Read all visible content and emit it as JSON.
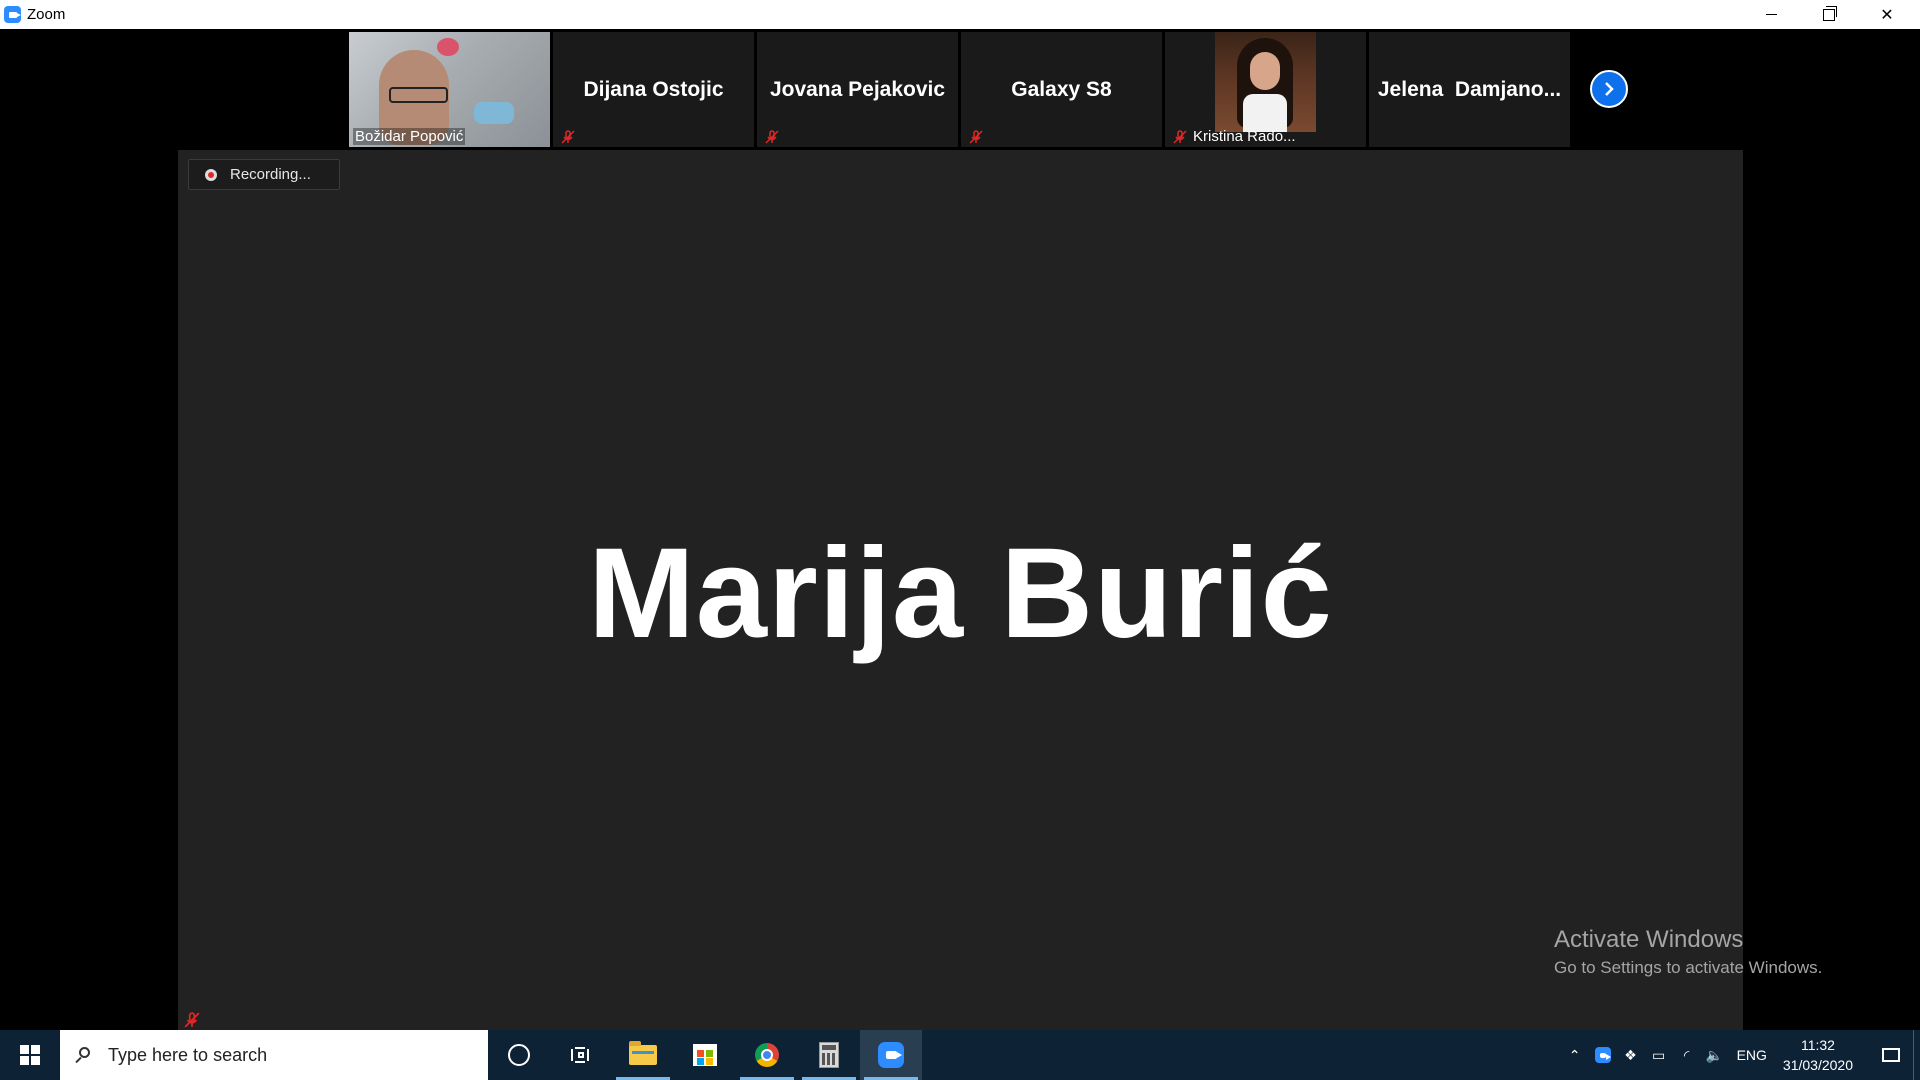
{
  "window": {
    "title": "Zoom"
  },
  "gallery": [
    {
      "name": "Božidar Popović",
      "type": "video",
      "muted": false
    },
    {
      "name": "Dijana Ostojic",
      "type": "name",
      "muted": true
    },
    {
      "name": "Jovana Pejakovic",
      "type": "name",
      "muted": true
    },
    {
      "name": "Galaxy S8",
      "type": "name",
      "muted": true
    },
    {
      "name": "Kristina Rado...",
      "type": "photo",
      "muted": true
    },
    {
      "name": "Jelena  Damjano...",
      "type": "name",
      "muted": false
    }
  ],
  "recording": {
    "label": "Recording..."
  },
  "active_speaker": {
    "name": "Marija Burić"
  },
  "watermark": {
    "title": "Activate Windows",
    "subtitle": "Go to Settings to activate Windows."
  },
  "taskbar": {
    "search_placeholder": "Type here to search",
    "apps": [
      "cortana-icon",
      "task-view-icon",
      "file-explorer-icon",
      "store-icon",
      "chrome-icon",
      "calculator-icon",
      "zoom-icon"
    ],
    "language": "ENG",
    "time": "11:32",
    "date": "31/03/2020"
  },
  "colors": {
    "zoom_blue": "#2D8CFF",
    "stage": "#222222",
    "taskbar": "#0E2236",
    "mute_red": "#E02828"
  }
}
